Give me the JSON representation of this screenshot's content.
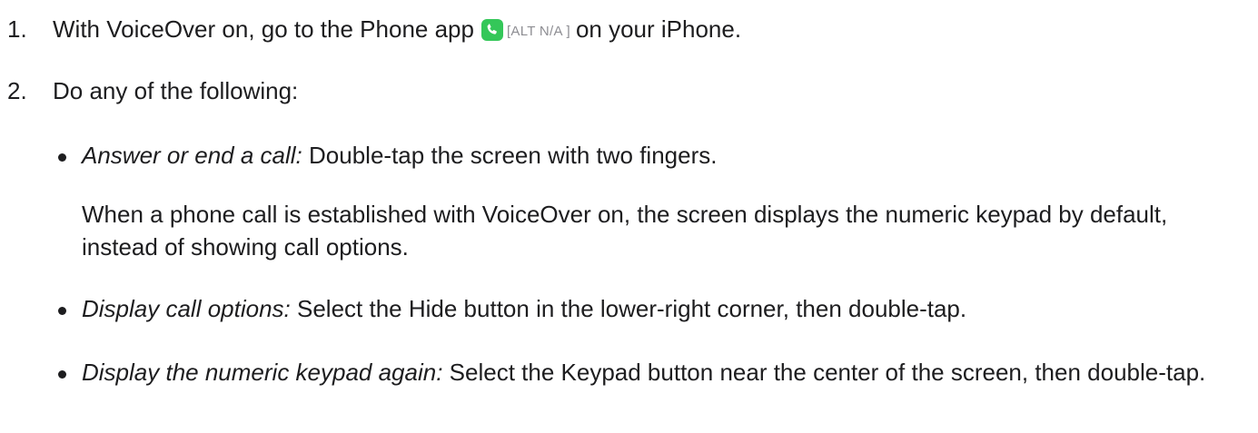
{
  "steps": [
    {
      "number": "1.",
      "text_before": "With VoiceOver on, go to the Phone app",
      "icon": "phone-app-icon",
      "icon_alt": "[ALT N/A ]",
      "text_after": "on your iPhone."
    },
    {
      "number": "2.",
      "text": "Do any of the following:"
    }
  ],
  "bullets": [
    {
      "term": "Answer or end a call:",
      "text": " Double-tap the screen with two fingers.",
      "note": "When a phone call is established with VoiceOver on, the screen displays the numeric keypad by default, instead of showing call options."
    },
    {
      "term": "Display call options:",
      "text": " Select the Hide button in the lower-right corner, then double-tap."
    },
    {
      "term": "Display the numeric keypad again:",
      "text": " Select the Keypad button near the center of the screen, then double-tap."
    }
  ],
  "colors": {
    "text": "#1d1d1f",
    "phone_icon": "#34c759",
    "alt_text": "#8e8e93"
  }
}
